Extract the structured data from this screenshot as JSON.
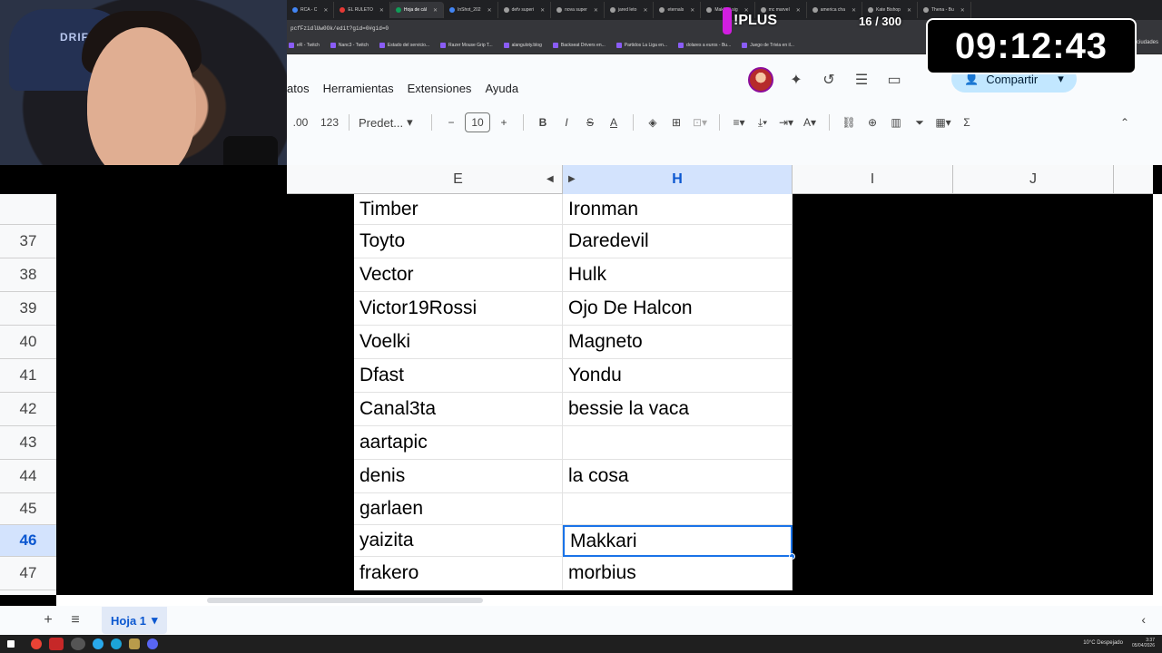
{
  "browser": {
    "tabs": [
      {
        "label": "RCA - C",
        "color": "#4285f4"
      },
      {
        "label": "EL RULETO",
        "color": "#e53935"
      },
      {
        "label": "Hoja de cál",
        "color": "#0f9d58",
        "active": true
      },
      {
        "label": "InShot_202",
        "color": "#4285f4"
      },
      {
        "label": "defv superi",
        "color": "#9e9e9e"
      },
      {
        "label": "nova super",
        "color": "#9e9e9e"
      },
      {
        "label": "jared leto",
        "color": "#9e9e9e"
      },
      {
        "label": "eternals",
        "color": "#9e9e9e"
      },
      {
        "label": "Makkari sig",
        "color": "#9e9e9e"
      },
      {
        "label": "mc marvel",
        "color": "#9e9e9e"
      },
      {
        "label": "america cha",
        "color": "#9e9e9e"
      },
      {
        "label": "Kate Bishop",
        "color": "#9e9e9e"
      },
      {
        "label": "Thena - Bu",
        "color": "#9e9e9e"
      }
    ],
    "url": "pcfFzidlUw0Ok/edit?gid=0#gid=0",
    "bookmarks": [
      "eR - Twitch",
      "Nanc3 - Twitch",
      "Estado del servicio...",
      "Razer Mouse Grip T...",
      "alanguloty.blog",
      "Backseat Drivers en...",
      "Partidos La Liga en...",
      "dolares a euros - Bu...",
      "Juego de Trivia en il..."
    ]
  },
  "overlay": {
    "plus_label": "!PLUS",
    "counter": "16 / 300",
    "timer": "09:12:43",
    "timer_side": "ciudades"
  },
  "sheets": {
    "menu": [
      "atos",
      "Herramientas",
      "Extensiones",
      "Ayuda"
    ],
    "share_label": "Compartir",
    "toolbar": {
      "decimals": ".00",
      "format_123": "123",
      "font_name": "Predet...",
      "font_size": "10",
      "bold": "B",
      "italic": "I",
      "strike": "S",
      "text_color": "A"
    },
    "columns": [
      {
        "label": "E"
      },
      {
        "label": "H",
        "selected": true
      },
      {
        "label": "I"
      },
      {
        "label": "J"
      }
    ],
    "rows": [
      {
        "num": "",
        "e": "Timber",
        "h": "Ironman"
      },
      {
        "num": "37",
        "e": "Toyto",
        "h": "Daredevil"
      },
      {
        "num": "38",
        "e": "Vector",
        "h": "Hulk"
      },
      {
        "num": "39",
        "e": "Victor19Rossi",
        "h": "Ojo De Halcon"
      },
      {
        "num": "40",
        "e": "Voelki",
        "h": "Magneto"
      },
      {
        "num": "41",
        "e": "Dfast",
        "h": "Yondu"
      },
      {
        "num": "42",
        "e": "Canal3ta",
        "h": "bessie la vaca"
      },
      {
        "num": "43",
        "e": "aartapic",
        "h": ""
      },
      {
        "num": "44",
        "e": "denis",
        "h": "la cosa"
      },
      {
        "num": "45",
        "e": "garlaen",
        "h": ""
      },
      {
        "num": "46",
        "e": "yaizita",
        "h": "Makkari",
        "selected": true
      },
      {
        "num": "47",
        "e": "frakero",
        "h": "morbius"
      }
    ],
    "sheet_tab": "Hoja 1"
  },
  "taskbar": {
    "weather": "10°C  Despejado",
    "time": "3:37",
    "date": "05/04/2026"
  }
}
